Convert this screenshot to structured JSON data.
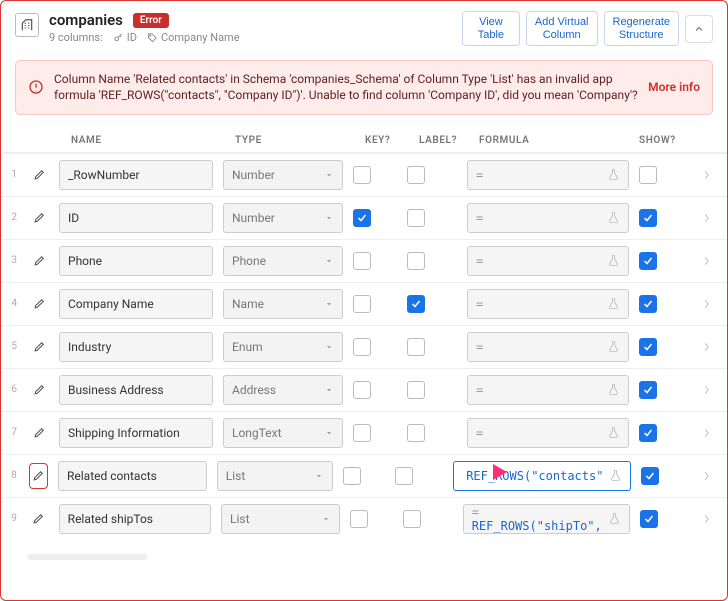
{
  "header": {
    "title": "companies",
    "columns_count_label": "9 columns:",
    "key_chip_label": "ID",
    "label_chip_label": "Company Name",
    "error_badge": "Error",
    "buttons": {
      "view_table": "View\nTable",
      "add_virtual": "Add Virtual\nColumn",
      "regenerate": "Regenerate\nStructure"
    }
  },
  "alert": {
    "text": "Column Name 'Related contacts' in Schema 'companies_Schema' of Column Type 'List' has an invalid app formula 'REF_ROWS(\"contacts\", \"Company ID\")'. Unable to find column 'Company ID', did you mean 'Company'?",
    "more": "More info"
  },
  "thead": {
    "name": "NAME",
    "type": "TYPE",
    "key": "KEY?",
    "label": "LABEL?",
    "formula": "FORMULA",
    "show": "SHOW?"
  },
  "rows": [
    {
      "idx": "1",
      "name": "_RowNumber",
      "type": "Number",
      "key": false,
      "label": false,
      "formula_eq": "=",
      "formula": "",
      "show": false,
      "highlight": false,
      "active": false
    },
    {
      "idx": "2",
      "name": "ID",
      "type": "Number",
      "key": true,
      "label": false,
      "formula_eq": "=",
      "formula": "",
      "show": true,
      "highlight": false,
      "active": false
    },
    {
      "idx": "3",
      "name": "Phone",
      "type": "Phone",
      "key": false,
      "label": false,
      "formula_eq": "=",
      "formula": "",
      "show": true,
      "highlight": false,
      "active": false
    },
    {
      "idx": "4",
      "name": "Company Name",
      "type": "Name",
      "key": false,
      "label": true,
      "formula_eq": "=",
      "formula": "",
      "show": true,
      "highlight": false,
      "active": false
    },
    {
      "idx": "5",
      "name": "Industry",
      "type": "Enum",
      "key": false,
      "label": false,
      "formula_eq": "=",
      "formula": "",
      "show": true,
      "highlight": false,
      "active": false
    },
    {
      "idx": "6",
      "name": "Business Address",
      "type": "Address",
      "key": false,
      "label": false,
      "formula_eq": "=",
      "formula": "",
      "show": true,
      "highlight": false,
      "active": false
    },
    {
      "idx": "7",
      "name": "Shipping Information",
      "type": "LongText",
      "key": false,
      "label": false,
      "formula_eq": "=",
      "formula": "",
      "show": true,
      "highlight": false,
      "active": false
    },
    {
      "idx": "8",
      "name": "Related contacts",
      "type": "List",
      "key": false,
      "label": false,
      "formula_eq": "",
      "formula": "REF_ROWS(\"contacts\"",
      "show": true,
      "highlight": true,
      "active": true
    },
    {
      "idx": "9",
      "name": "Related shipTos",
      "type": "List",
      "key": false,
      "label": false,
      "formula_eq": "= ",
      "formula": "REF_ROWS(\"shipTo\",",
      "show": true,
      "highlight": false,
      "active": false
    }
  ]
}
